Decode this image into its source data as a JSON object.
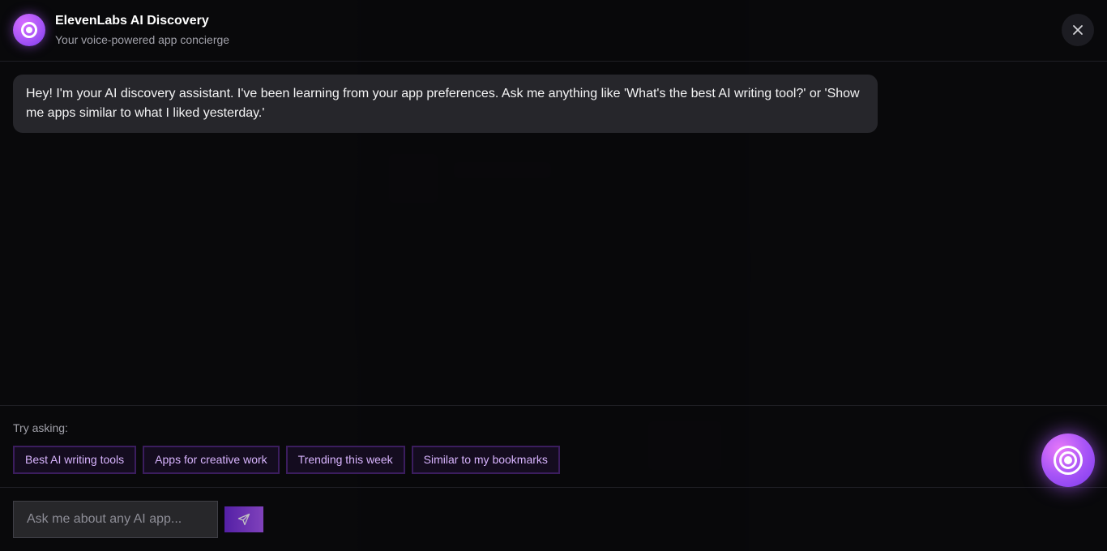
{
  "header": {
    "title": "ElevenLabs AI Discovery",
    "subtitle": "Your voice-powered app concierge",
    "logo_icon": "voice-orb-icon",
    "close_icon": "close-icon"
  },
  "chat": {
    "messages": [
      {
        "role": "assistant",
        "text": "Hey! I'm your AI discovery assistant. I've been learning from your app preferences. Ask me anything like 'What's the best AI writing tool?' or 'Show me apps similar to what I liked yesterday.'"
      }
    ]
  },
  "suggestions": {
    "label": "Try asking:",
    "chips": [
      "Best AI writing tools",
      "Apps for creative work",
      "Trending this week",
      "Similar to my bookmarks"
    ]
  },
  "input": {
    "placeholder": "Ask me about any AI app...",
    "value": "",
    "send_icon": "send-icon"
  },
  "colors": {
    "accent": "#a855f7",
    "chip_text": "#d8b4fe",
    "background": "#09090b"
  }
}
